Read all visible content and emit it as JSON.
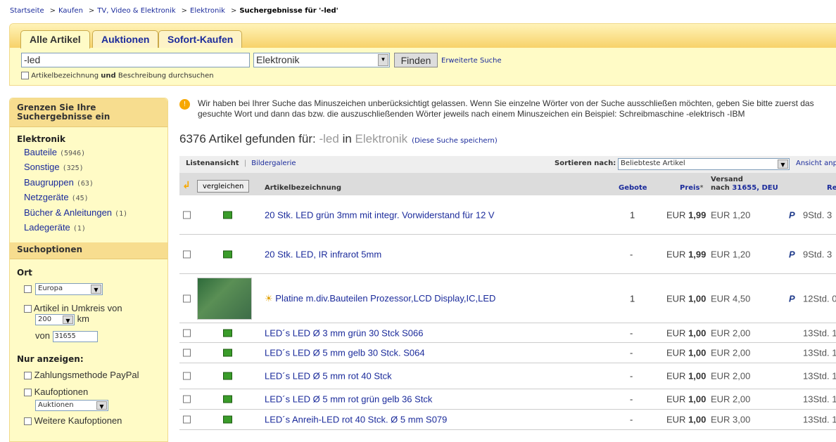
{
  "breadcrumb": [
    "Startseite",
    "Kaufen",
    "TV, Video & Elektronik",
    "Elektronik"
  ],
  "breadcrumb_current": "Suchergebnisse für '-led'",
  "tabs": [
    "Alle Artikel",
    "Auktionen",
    "Sofort-Kaufen"
  ],
  "search": {
    "query": "-led",
    "category": "Elektronik",
    "button": "Finden",
    "advanced": "Erweiterte Suche",
    "desc_pre": "Artikelbezeichnung ",
    "desc_bold": "und",
    "desc_post": " Beschreibung durchsuchen"
  },
  "sidebar": {
    "title": "Grenzen Sie Ihre Suchergebnisse ein",
    "cat_heading": "Elektronik",
    "categories": [
      {
        "label": "Bauteile",
        "count": "(5946)"
      },
      {
        "label": "Sonstige",
        "count": "(325)"
      },
      {
        "label": "Baugruppen",
        "count": "(63)"
      },
      {
        "label": "Netzgeräte",
        "count": "(45)"
      },
      {
        "label": "Bücher & Anleitungen",
        "count": "(1)"
      },
      {
        "label": "Ladegeräte",
        "count": "(1)"
      }
    ],
    "options_title": "Suchoptionen",
    "ort": "Ort",
    "region": "Europa",
    "umkreis": "Artikel in Umkreis von",
    "km_value": "200",
    "km": "km",
    "von": "von",
    "plz": "31655",
    "nur": "Nur anzeigen:",
    "paypal": "Zahlungsmethode PayPal",
    "kauf": "Kaufoptionen",
    "kauf_value": "Auktionen",
    "weitere": "Weitere Kaufoptionen"
  },
  "notice": "Wir haben bei Ihrer Suche das Minuszeichen unberücksichtigt gelassen. Wenn Sie einzelne Wörter von der Suche ausschließen möchten, geben Sie bitte zuerst das gesuchte Wort und dann das bzw. die auszuschließenden Wörter jeweils nach einem Minuszeichen ein Beispiel: Schreibmaschine -elektrisch -IBM",
  "results": {
    "count": "6376",
    "found": " Artikel gefunden für: ",
    "term": "-led",
    "in": " in ",
    "cat": "Elektronik",
    "save": "(Diese Suche speichern)"
  },
  "toolbar": {
    "list": "Listenansicht",
    "gallery": "Bildergalerie",
    "sort_label": "Sortieren nach:",
    "sort_value": "Beliebteste Artikel",
    "view": "Ansicht anpassen"
  },
  "columns": {
    "compare": "vergleichen",
    "title": "Artikelbezeichnung",
    "bids": "Gebote",
    "price": "Preis",
    "star": "*",
    "ship1": "Versand",
    "ship2": "nach ",
    "ship_loc": "31655, DEU",
    "rest": "Restzeit"
  },
  "items": [
    {
      "title": "20 Stk. LED grün 3mm mit integr. Vorwiderstand für 12 V",
      "bids": "1",
      "cur": "EUR ",
      "price": "1,99",
      "ship": "EUR 1,20",
      "paypal": "P",
      "time": "9Std. 3"
    },
    {
      "title": "20 Stk. LED, IR infrarot 5mm",
      "bids": "-",
      "cur": "EUR ",
      "price": "1,99",
      "ship": "EUR 1,20",
      "paypal": "P",
      "time": "9Std. 3"
    },
    {
      "title": "Platine m.div.Bauteilen Prozessor,LCD Display,IC,LED",
      "bids": "1",
      "cur": "EUR ",
      "price": "1,00",
      "ship": "EUR 4,50",
      "paypal": "P",
      "time": "12Std. 0"
    },
    {
      "title": "LED´s LED Ø 3 mm grün 30 Stck S066",
      "bids": "-",
      "cur": "EUR ",
      "price": "1,00",
      "ship": "EUR 2,00",
      "time": "13Std. 1"
    },
    {
      "title": "LED´s LED Ø 5 mm gelb 30 Stck. S064",
      "bids": "-",
      "cur": "EUR ",
      "price": "1,00",
      "ship": "EUR 2,00",
      "time": "13Std. 1"
    },
    {
      "title": "LED´s LED Ø 5 mm rot 40 Stck",
      "bids": "-",
      "cur": "EUR ",
      "price": "1,00",
      "ship": "EUR 2,00",
      "time": "13Std. 1"
    },
    {
      "title": "LED´s LED Ø 5 mm rot grün gelb 36 Stck",
      "bids": "-",
      "cur": "EUR ",
      "price": "1,00",
      "ship": "EUR 2,00",
      "time": "13Std. 1"
    },
    {
      "title": "LED´s Anreih-LED rot 40 Stck. Ø 5 mm S079",
      "bids": "-",
      "cur": "EUR ",
      "price": "1,00",
      "ship": "EUR 3,00",
      "time": "13Std. 1"
    }
  ]
}
